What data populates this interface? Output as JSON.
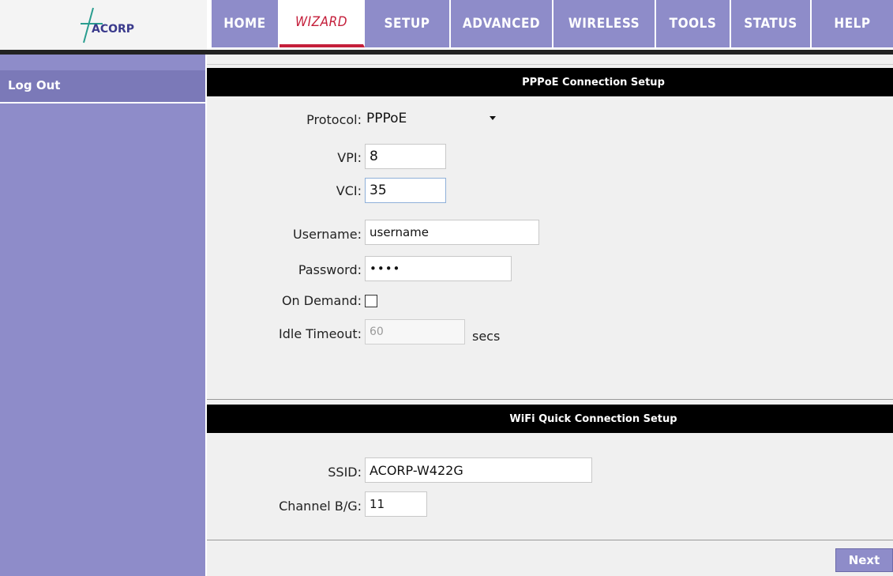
{
  "logo": {
    "text": "ACORP"
  },
  "nav": {
    "tabs": [
      {
        "label": "HOME"
      },
      {
        "label": "WIZARD"
      },
      {
        "label": "SETUP"
      },
      {
        "label": "ADVANCED"
      },
      {
        "label": "WIRELESS"
      },
      {
        "label": "TOOLS"
      },
      {
        "label": "STATUS"
      },
      {
        "label": "HELP"
      }
    ],
    "active": "WIZARD"
  },
  "sidebar": {
    "items": [
      {
        "label": "Log Out"
      }
    ]
  },
  "pppoe": {
    "title": "PPPoE Connection Setup",
    "protocol_label": "Protocol:",
    "protocol_value": "PPPoE",
    "vpi_label": "VPI:",
    "vpi_value": "8",
    "vci_label": "VCI:",
    "vci_value": "35",
    "username_label": "Username:",
    "username_value": "username",
    "password_label": "Password:",
    "password_value": "••••",
    "ondemand_label": "On Demand:",
    "ondemand_checked": false,
    "idle_label": "Idle Timeout:",
    "idle_value": "60",
    "idle_unit": "secs"
  },
  "wifi": {
    "title": "WiFi Quick Connection Setup",
    "ssid_label": "SSID:",
    "ssid_value": "ACORP-W422G",
    "channel_label": "Channel B/G:",
    "channel_value": "11"
  },
  "actions": {
    "next_label": "Next"
  },
  "colors": {
    "nav": "#8e8cc9",
    "sidebar": "#8e8cc9",
    "accent": "#c41e3a",
    "bar": "#000000"
  }
}
